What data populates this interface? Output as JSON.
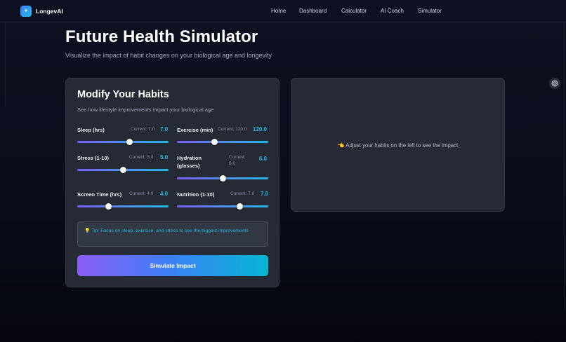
{
  "brand": {
    "name": "LongevAI",
    "logo_glyph": "⟡"
  },
  "nav": {
    "links": [
      "Home",
      "Dashboard",
      "Calculator",
      "AI Coach",
      "Simulator"
    ]
  },
  "header": {
    "title": "Future Health Simulator",
    "subtitle": "Visualize the impact of habit changes on your biological age and longevity"
  },
  "habits_card": {
    "title": "Modify Your Habits",
    "subtitle": "See how lifestyle improvements impact your biological age",
    "habits": [
      {
        "label": "Sleep (hrs)",
        "current": "Current: 7.0",
        "value": "7.0",
        "fraction": 0.57
      },
      {
        "label": "Exercise (min)",
        "current": "Current: 120.0",
        "value": "120.0",
        "fraction": 0.41
      },
      {
        "label": "Stress (1-10)",
        "current": "Current: 5.0",
        "value": "5.0",
        "fraction": 0.5
      },
      {
        "label": "Hydration (glasses)",
        "current": "Current: 6.0",
        "value": "6.0",
        "fraction": 0.5
      },
      {
        "label": "Screen Time (hrs)",
        "current": "Current: 4.0",
        "value": "4.0",
        "fraction": 0.34
      },
      {
        "label": "Nutrition (1-10)",
        "current": "Current: 7.0",
        "value": "7.0",
        "fraction": 0.69
      }
    ],
    "tip": {
      "icon": "lightbulb-icon",
      "text": "💡 Tip: Focus on sleep, exercise, and stress to see the biggest improvements"
    },
    "button_label": "Simulate Impact"
  },
  "results_card": {
    "placeholder": "👈 Adjust your habits on the left to see the impact"
  },
  "side_icon": "swirl-icon",
  "colors": {
    "accent_cyan": "#22b8e6",
    "accent_purple": "#8b5cf6",
    "accent_blue": "#3b82f6",
    "card_bg": "#262a35",
    "page_bg": "#0d1020"
  }
}
